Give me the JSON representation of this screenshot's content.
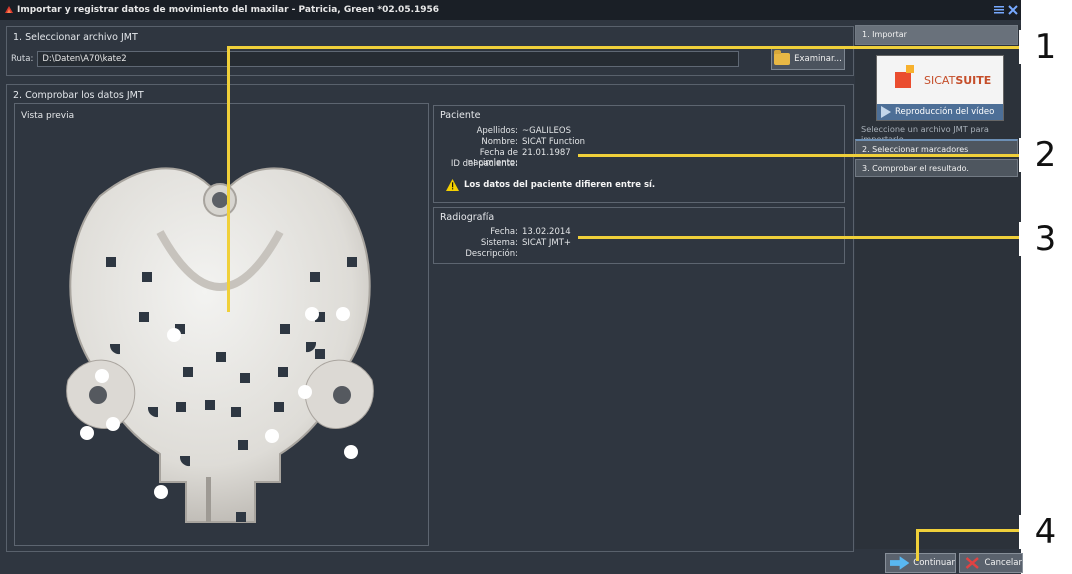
{
  "window": {
    "title": "Importar y registrar datos de movimiento del maxilar - Patricia, Green *02.05.1956"
  },
  "section1": {
    "title": "1. Seleccionar archivo JMT",
    "path_label": "Ruta:",
    "path_value": "D:\\Daten\\A70\\kate2",
    "browse_label": "Examinar..."
  },
  "section2": {
    "title": "2. Comprobar los datos JMT",
    "preview_title": "Vista previa"
  },
  "patient": {
    "title": "Paciente",
    "rows": [
      {
        "label": "Apellidos:",
        "value": "~GALILEOS"
      },
      {
        "label": "Nombre:",
        "value": "SICAT Function"
      },
      {
        "label": "Fecha de nacimiento:",
        "value": "21.01.1987"
      },
      {
        "label": "ID del paciente:",
        "value": ""
      }
    ],
    "warning": "Los datos del paciente difieren entre sí."
  },
  "radiography": {
    "title": "Radiografía",
    "rows": [
      {
        "label": "Fecha:",
        "value": "13.02.2014"
      },
      {
        "label": "Sistema:",
        "value": "SICAT JMT+"
      },
      {
        "label": "Descripción:",
        "value": ""
      }
    ]
  },
  "sidebar": {
    "steps": [
      {
        "label": "1. Importar"
      },
      {
        "label": "2. Seleccionar marcadores"
      },
      {
        "label": "3. Comprobar el resultado."
      }
    ],
    "video_label": "Reproducción del vídeo",
    "brand_text": "SICAT",
    "brand_bold": "SUITE",
    "hint": "Seleccione un archivo JMT para importarlo."
  },
  "footer": {
    "continue_label": "Continuar",
    "cancel_label": "Cancelar"
  },
  "callouts": [
    "1",
    "2",
    "3",
    "4"
  ],
  "colors": {
    "app_bg": "#2f3640",
    "accent_line": "#f0d03a",
    "step_active": "#69717b",
    "step_indicator": "#6c8fb5",
    "warning": "#f4d000"
  },
  "icons": [
    "folder-icon",
    "warning-icon",
    "play-icon",
    "arrow-right-icon",
    "close-icon"
  ]
}
